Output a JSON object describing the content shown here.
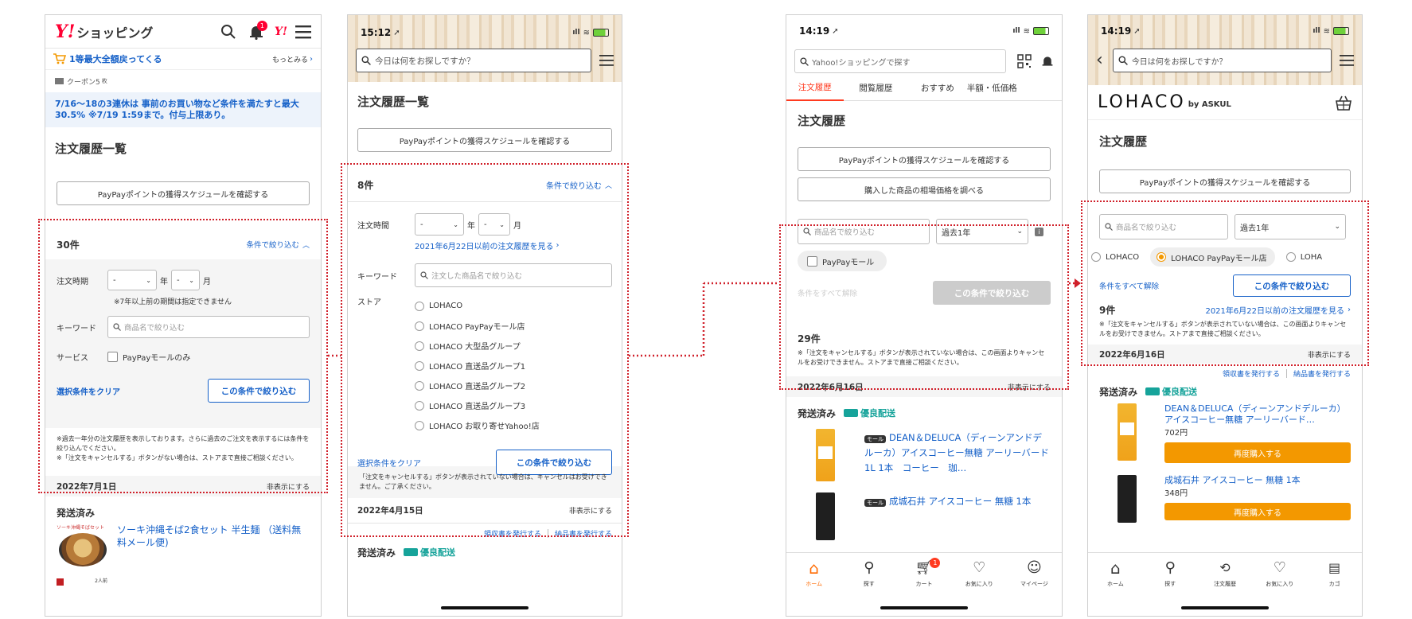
{
  "s1": {
    "logo": "Y!",
    "app_name": "ショッピング",
    "notification_count": "1",
    "campaign_text": "1等最大全額戻ってくる",
    "campaign_more": "もっとみる",
    "coupon_text": "クーポン5",
    "coupon_unit": "枚",
    "notice": "7/16〜18の3連休は 事前のお買い物など条件を満たすと最大30.5% ※7/19 1:59まで。付与上限あり。",
    "title": "注文履歴一覧",
    "paypay_btn": "PayPayポイントの獲得スケジュールを確認する",
    "count": "30件",
    "filter_toggle": "条件で絞り込む",
    "period_label": "注文時期",
    "year_value": "-",
    "year_unit": "年",
    "month_value": "-",
    "month_unit": "月",
    "period_note": "※7年以上前の期間は指定できません",
    "keyword_label": "キーワード",
    "keyword_placeholder": "商品名で絞り込む",
    "service_label": "サービス",
    "service_option": "PayPayモールのみ",
    "clear": "選択条件をクリア",
    "apply": "この条件で絞り込む",
    "note1": "※過去一年分の注文履歴を表示しております。さらに過去のご注文を表示するには条件を絞り込んでください。",
    "note2": "※「注文をキャンセルする」ボタンがない場合は、ストアまで直接ご相談ください。",
    "date": "2022年7月1日",
    "hide": "非表示にする",
    "status": "発送済み",
    "item_title": "ソーキ沖縄そば2食セット 半生麺 （送料無料メール便)",
    "thumb_label": "ソーキ沖縄そばセット",
    "thumb_badge": "2人前"
  },
  "s2": {
    "time": "15:12",
    "search_placeholder": "今日は何をお探しですか？",
    "title": "注文履歴一覧",
    "paypay_btn": "PayPayポイントの獲得スケジュールを確認する",
    "count": "8件",
    "filter_toggle": "条件で絞り込む",
    "period_label": "注文時間",
    "year_value": "-",
    "year_unit": "年",
    "month_value": "-",
    "month_unit": "月",
    "old_link": "2021年6月22日以前の注文履歴を見る",
    "keyword_label": "キーワード",
    "keyword_placeholder": "注文した商品名で絞り込む",
    "store_label": "ストア",
    "stores": [
      "LOHACO",
      "LOHACO PayPayモール店",
      "LOHACO 大型品グループ",
      "LOHACO 直送品グループ1",
      "LOHACO 直送品グループ2",
      "LOHACO 直送品グループ3",
      "LOHACO お取り寄せYahoo!店"
    ],
    "clear": "選択条件をクリア",
    "apply": "この条件で絞り込む",
    "note": "「注文をキャンセルする」ボタンが表示されていない場合は、キャンセルはお受けできません。ご了承ください。",
    "date": "2022年4月15日",
    "hide": "非表示にする",
    "receipt": "領収書を発行する",
    "invoice": "納品書を発行する",
    "status": "発送済み",
    "shipping": "優良配送"
  },
  "s3": {
    "time": "14:19",
    "search_placeholder": "Yahoo!ショッピングで探す",
    "tabs": [
      "注文履歴",
      "閲覧履歴",
      "おすすめ",
      "半額・低価格"
    ],
    "title": "注文履歴",
    "paypay_btn": "PayPayポイントの獲得スケジュールを確認する",
    "market_btn": "購入した商品の相場価格を調べる",
    "keyword_placeholder": "商品名で絞り込む",
    "period_value": "過去1年",
    "mall_chip": "PayPayモール",
    "clear": "条件をすべて解除",
    "apply": "この条件で絞り込む",
    "count": "29件",
    "note": "※「注文をキャンセルする」ボタンが表示されていない場合は、この画面よりキャンセルをお受けできません。ストアまで直接ご相談ください。",
    "date": "2022年6月16日",
    "hide": "非表示にする",
    "status": "発送済み",
    "shipping": "優良配送",
    "badge": "モール",
    "item1": "DEAN＆DELUCA（ディーンアンドデルーカ）アイスコーヒー無糖 アーリーバード 1L 1本　コーヒー　珈…",
    "item2": "成城石井 アイスコーヒー 無糖 1本",
    "cart_count": "1",
    "nav": [
      "ホーム",
      "探す",
      "カート",
      "お気に入り",
      "マイページ"
    ]
  },
  "s4": {
    "time": "14:19",
    "search_placeholder": "今日は何をお探しですか？",
    "logo_main": "LOHACO",
    "logo_sub": "by ASKUL",
    "title": "注文履歴",
    "paypay_btn": "PayPayポイントの獲得スケジュールを確認する",
    "keyword_placeholder": "商品名で絞り込む",
    "period_value": "過去1年",
    "radios": [
      "LOHACO",
      "LOHACO PayPayモール店",
      "LOHA"
    ],
    "clear": "条件をすべて解除",
    "apply": "この条件で絞り込む",
    "count": "9件",
    "old_link": "2021年6月22日以前の注文履歴を見る",
    "note": "※「注文をキャンセルする」ボタンが表示されていない場合は、この画面よりキャンセルをお受けできません。ストアまで直接ご相談ください。",
    "date": "2022年6月16日",
    "hide": "非表示にする",
    "receipt": "領収書を発行する",
    "invoice": "納品書を発行する",
    "status": "発送済み",
    "shipping": "優良配送",
    "item1": "DEAN＆DELUCA（ディーンアンドデルーカ）アイスコーヒー無糖 アーリーバード…",
    "price1": "702円",
    "rebuy": "再度購入する",
    "item2": "成城石井 アイスコーヒー 無糖 1本",
    "price2": "348円",
    "nav": [
      "ホーム",
      "探す",
      "注文履歴",
      "お気に入り",
      "カゴ"
    ]
  },
  "colors": {
    "link": "#1560c8",
    "highlight": "#d0202a",
    "orange": "#f39800",
    "brand_red": "#ff0033",
    "teal": "#16a39a"
  }
}
